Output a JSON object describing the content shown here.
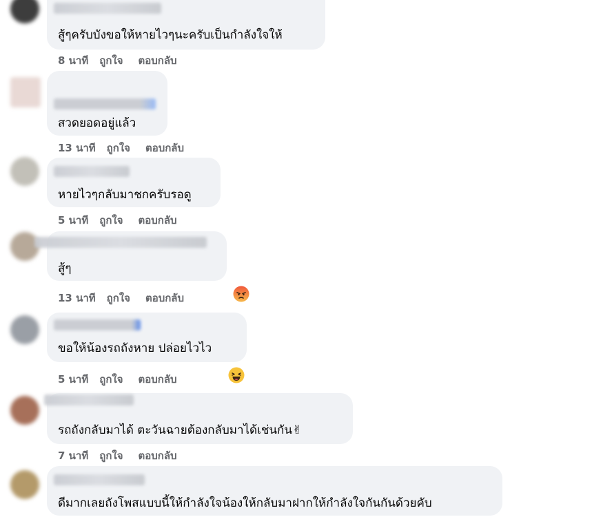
{
  "comments": [
    {
      "text": "สู้ๆครับบังขอให้หายไวๆนะครับเป็นกำลังใจให้",
      "time": "8 นาที",
      "like": "ถูกใจ",
      "reply": "ตอบกลับ",
      "reaction": ""
    },
    {
      "text": "สวดยอดอยู่แล้ว",
      "time": "13 นาที",
      "like": "ถูกใจ",
      "reply": "ตอบกลับ",
      "reaction": ""
    },
    {
      "text": "หายไวๆกลับมาชกครับรอดู",
      "time": "5 นาที",
      "like": "ถูกใจ",
      "reply": "ตอบกลับ",
      "reaction": ""
    },
    {
      "text": "สู้ๆ",
      "time": "13 นาที",
      "like": "ถูกใจ",
      "reply": "ตอบกลับ",
      "reaction": "angry"
    },
    {
      "text": "ขอให้น้องรถถังหาย ปล่อยไวไว",
      "time": "5 นาที",
      "like": "ถูกใจ",
      "reply": "ตอบกลับ",
      "reaction": "haha"
    },
    {
      "text": "รถถังกลับมาได้ ตะวันฉายต้องกลับมาได้เช่นกัน✌",
      "time": "7 นาที",
      "like": "ถูกใจ",
      "reply": "ตอบกลับ",
      "reaction": ""
    },
    {
      "text": "ดีมากเลยถังโพสแบบนี้ให้กำลังใจน้องให้กลับมาฝากให้กำลังใจกันกันด้วยคับ",
      "time": "",
      "like": "",
      "reply": "",
      "reaction": ""
    }
  ],
  "colors": {
    "bubble": "#f0f2f5",
    "meta": "#65676b",
    "text": "#050505"
  }
}
